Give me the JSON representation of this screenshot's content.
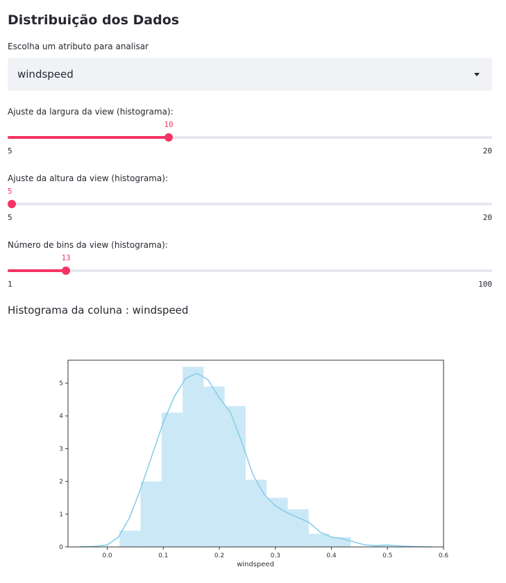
{
  "header": {
    "title": "Distribuição dos Dados"
  },
  "attribute_select": {
    "label": "Escolha um atributo para analisar",
    "value": "windspeed",
    "caret_icon": "chevron-down-icon"
  },
  "sliders": [
    {
      "label": "Ajuste da largura da view (histograma):",
      "value": "10",
      "min": "5",
      "max": "20",
      "fraction": 0.333
    },
    {
      "label": "Ajuste da altura da view (histograma):",
      "value": "5",
      "min": "5",
      "max": "20",
      "fraction": 0.0
    },
    {
      "label": "Número de bins da view (histograma):",
      "value": "13",
      "min": "1",
      "max": "100",
      "fraction": 0.121
    }
  ],
  "histogram": {
    "subheader": "Histograma da coluna : windspeed"
  },
  "colors": {
    "accent": "#f63366",
    "bars": "#a8d8f0",
    "kde": "#87ceeb"
  },
  "chart_data": {
    "type": "bar",
    "xlabel": "windspeed",
    "ylabel": "",
    "xlim": [
      -0.07,
      0.6
    ],
    "ylim": [
      0,
      5.7
    ],
    "xticks": [
      "0.0",
      "0.1",
      "0.2",
      "0.3",
      "0.4",
      "0.5",
      "0.6"
    ],
    "xtick_values": [
      0.0,
      0.1,
      0.2,
      0.3,
      0.4,
      0.5,
      0.6
    ],
    "yticks": [
      "0",
      "1",
      "2",
      "3",
      "4",
      "5"
    ],
    "ytick_values": [
      0,
      1,
      2,
      3,
      4,
      5
    ],
    "bin_edges": [
      0.022,
      0.0595,
      0.097,
      0.1345,
      0.172,
      0.2095,
      0.247,
      0.2845,
      0.322,
      0.3595,
      0.397,
      0.4345,
      0.472,
      0.5095
    ],
    "values": [
      0.5,
      2.0,
      4.1,
      5.5,
      4.9,
      4.3,
      2.05,
      1.5,
      1.15,
      0.4,
      0.3,
      0.0,
      0.05
    ],
    "kde": {
      "x": [
        -0.05,
        -0.02,
        0.0,
        0.02,
        0.04,
        0.06,
        0.08,
        0.1,
        0.12,
        0.14,
        0.16,
        0.18,
        0.2,
        0.22,
        0.24,
        0.26,
        0.28,
        0.3,
        0.32,
        0.34,
        0.36,
        0.38,
        0.4,
        0.42,
        0.44,
        0.46,
        0.48,
        0.5,
        0.52,
        0.55,
        0.58
      ],
      "y": [
        0.0,
        0.02,
        0.06,
        0.3,
        0.9,
        1.8,
        2.8,
        3.8,
        4.6,
        5.15,
        5.3,
        5.1,
        4.55,
        4.1,
        3.2,
        2.2,
        1.6,
        1.25,
        1.05,
        0.9,
        0.75,
        0.45,
        0.3,
        0.25,
        0.15,
        0.06,
        0.04,
        0.06,
        0.03,
        0.01,
        0.0
      ]
    }
  }
}
